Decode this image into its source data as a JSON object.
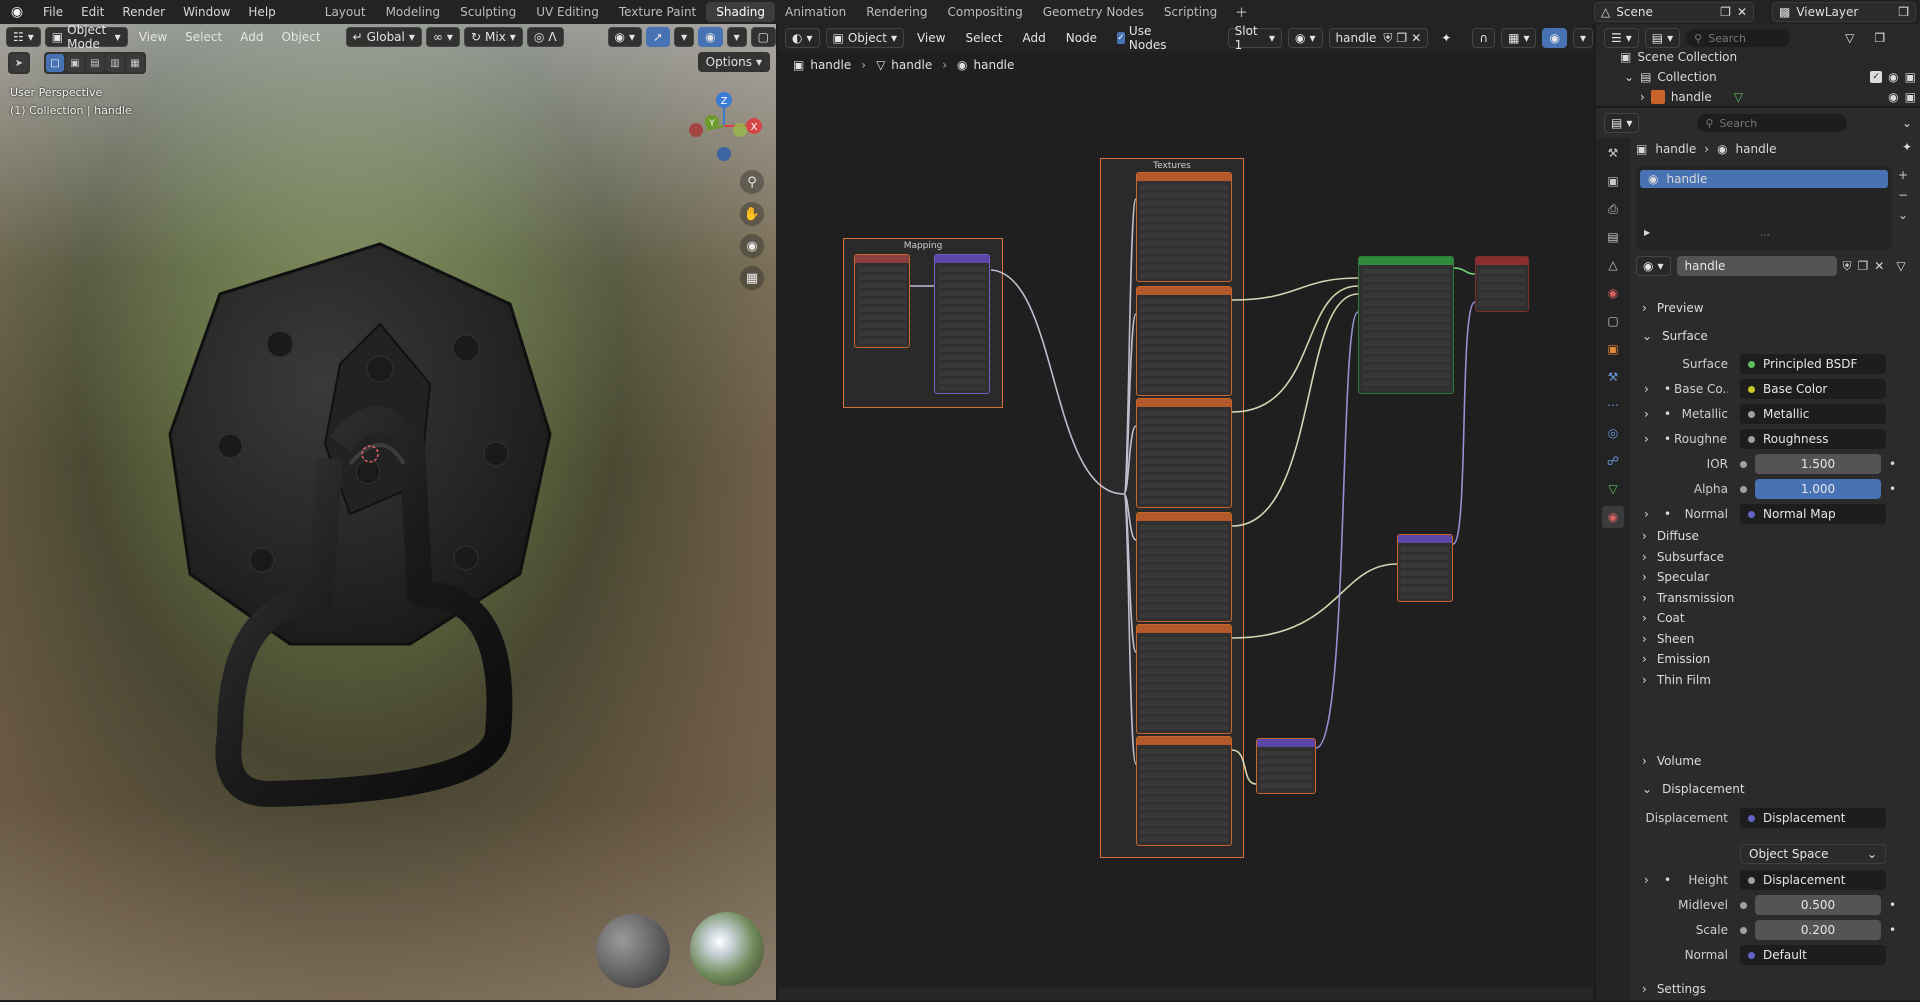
{
  "menu": [
    "File",
    "Edit",
    "Render",
    "Window",
    "Help"
  ],
  "workspaces": [
    {
      "label": "Layout"
    },
    {
      "label": "Modeling"
    },
    {
      "label": "Sculpting"
    },
    {
      "label": "UV Editing"
    },
    {
      "label": "Texture Paint"
    },
    {
      "label": "Shading",
      "active": true
    },
    {
      "label": "Animation"
    },
    {
      "label": "Rendering"
    },
    {
      "label": "Compositing"
    },
    {
      "label": "Geometry Nodes"
    },
    {
      "label": "Scripting"
    }
  ],
  "scene": {
    "name": "Scene",
    "view_layer": "ViewLayer"
  },
  "viewport": {
    "mode": "Object Mode",
    "menus": [
      "View",
      "Select",
      "Add",
      "Object"
    ],
    "orientation": "Global",
    "pivot": "Mix",
    "options": "Options",
    "overlay_line1": "User Perspective",
    "overlay_line2": "(1) Collection | handle",
    "gizmo": {
      "x": "X",
      "y": "Y",
      "z": "Z"
    }
  },
  "node_editor": {
    "object_mode": "Object",
    "menus": [
      "View",
      "Select",
      "Add",
      "Node"
    ],
    "use_nodes": "Use Nodes",
    "slot": "Slot 1",
    "material": "handle",
    "breadcrumbs": [
      "handle",
      "handle",
      "handle"
    ],
    "frames": {
      "mapping": "Mapping",
      "textures": "Textures"
    }
  },
  "outliner": {
    "search_placeholder": "Search",
    "scene_collection": "Scene Collection",
    "collection": "Collection",
    "object": "handle"
  },
  "properties": {
    "search_placeholder": "Search",
    "crumb_object": "handle",
    "crumb_material": "handle",
    "slot_item": "handle",
    "material_name": "handle",
    "sections": {
      "preview": "Preview",
      "surface": "Surface",
      "volume": "Volume",
      "displacement": "Displacement",
      "settings": "Settings"
    },
    "surface_rows": [
      {
        "label": "Surface",
        "value": "Principled BSDF",
        "dot": "#5fbf5f"
      },
      {
        "label": "Base Co...",
        "value": "Base Color",
        "dot": "#c7c729",
        "expand": true
      },
      {
        "label": "Metallic",
        "value": "Metallic",
        "dot": "#a1a1a1",
        "expand": true
      },
      {
        "label": "Roughne...",
        "value": "Roughness",
        "dot": "#a1a1a1",
        "expand": true
      },
      {
        "label": "IOR",
        "value": "1.500",
        "dot": "#a1a1a1",
        "num": true
      },
      {
        "label": "Alpha",
        "value": "1.000",
        "dot": "#a1a1a1",
        "num": true,
        "blue": true
      },
      {
        "label": "Normal",
        "value": "Normal Map",
        "dot": "#6363c7",
        "expand": true
      }
    ],
    "sub_sections": [
      "Diffuse",
      "Subsurface",
      "Specular",
      "Transmission",
      "Coat",
      "Sheen",
      "Emission",
      "Thin Film"
    ],
    "displacement": {
      "label": "Displacement",
      "value": "Displacement",
      "space": "Object Space",
      "height_label": "Height",
      "height_value": "Displacement",
      "midlevel_label": "Midlevel",
      "midlevel_value": "0.500",
      "scale_label": "Scale",
      "scale_value": "0.200",
      "normal_label": "Normal",
      "normal_value": "Default"
    }
  },
  "colors": {
    "accent": "#4772b3",
    "frame_border": "#d6713a",
    "wire": "#c8c8c8"
  }
}
